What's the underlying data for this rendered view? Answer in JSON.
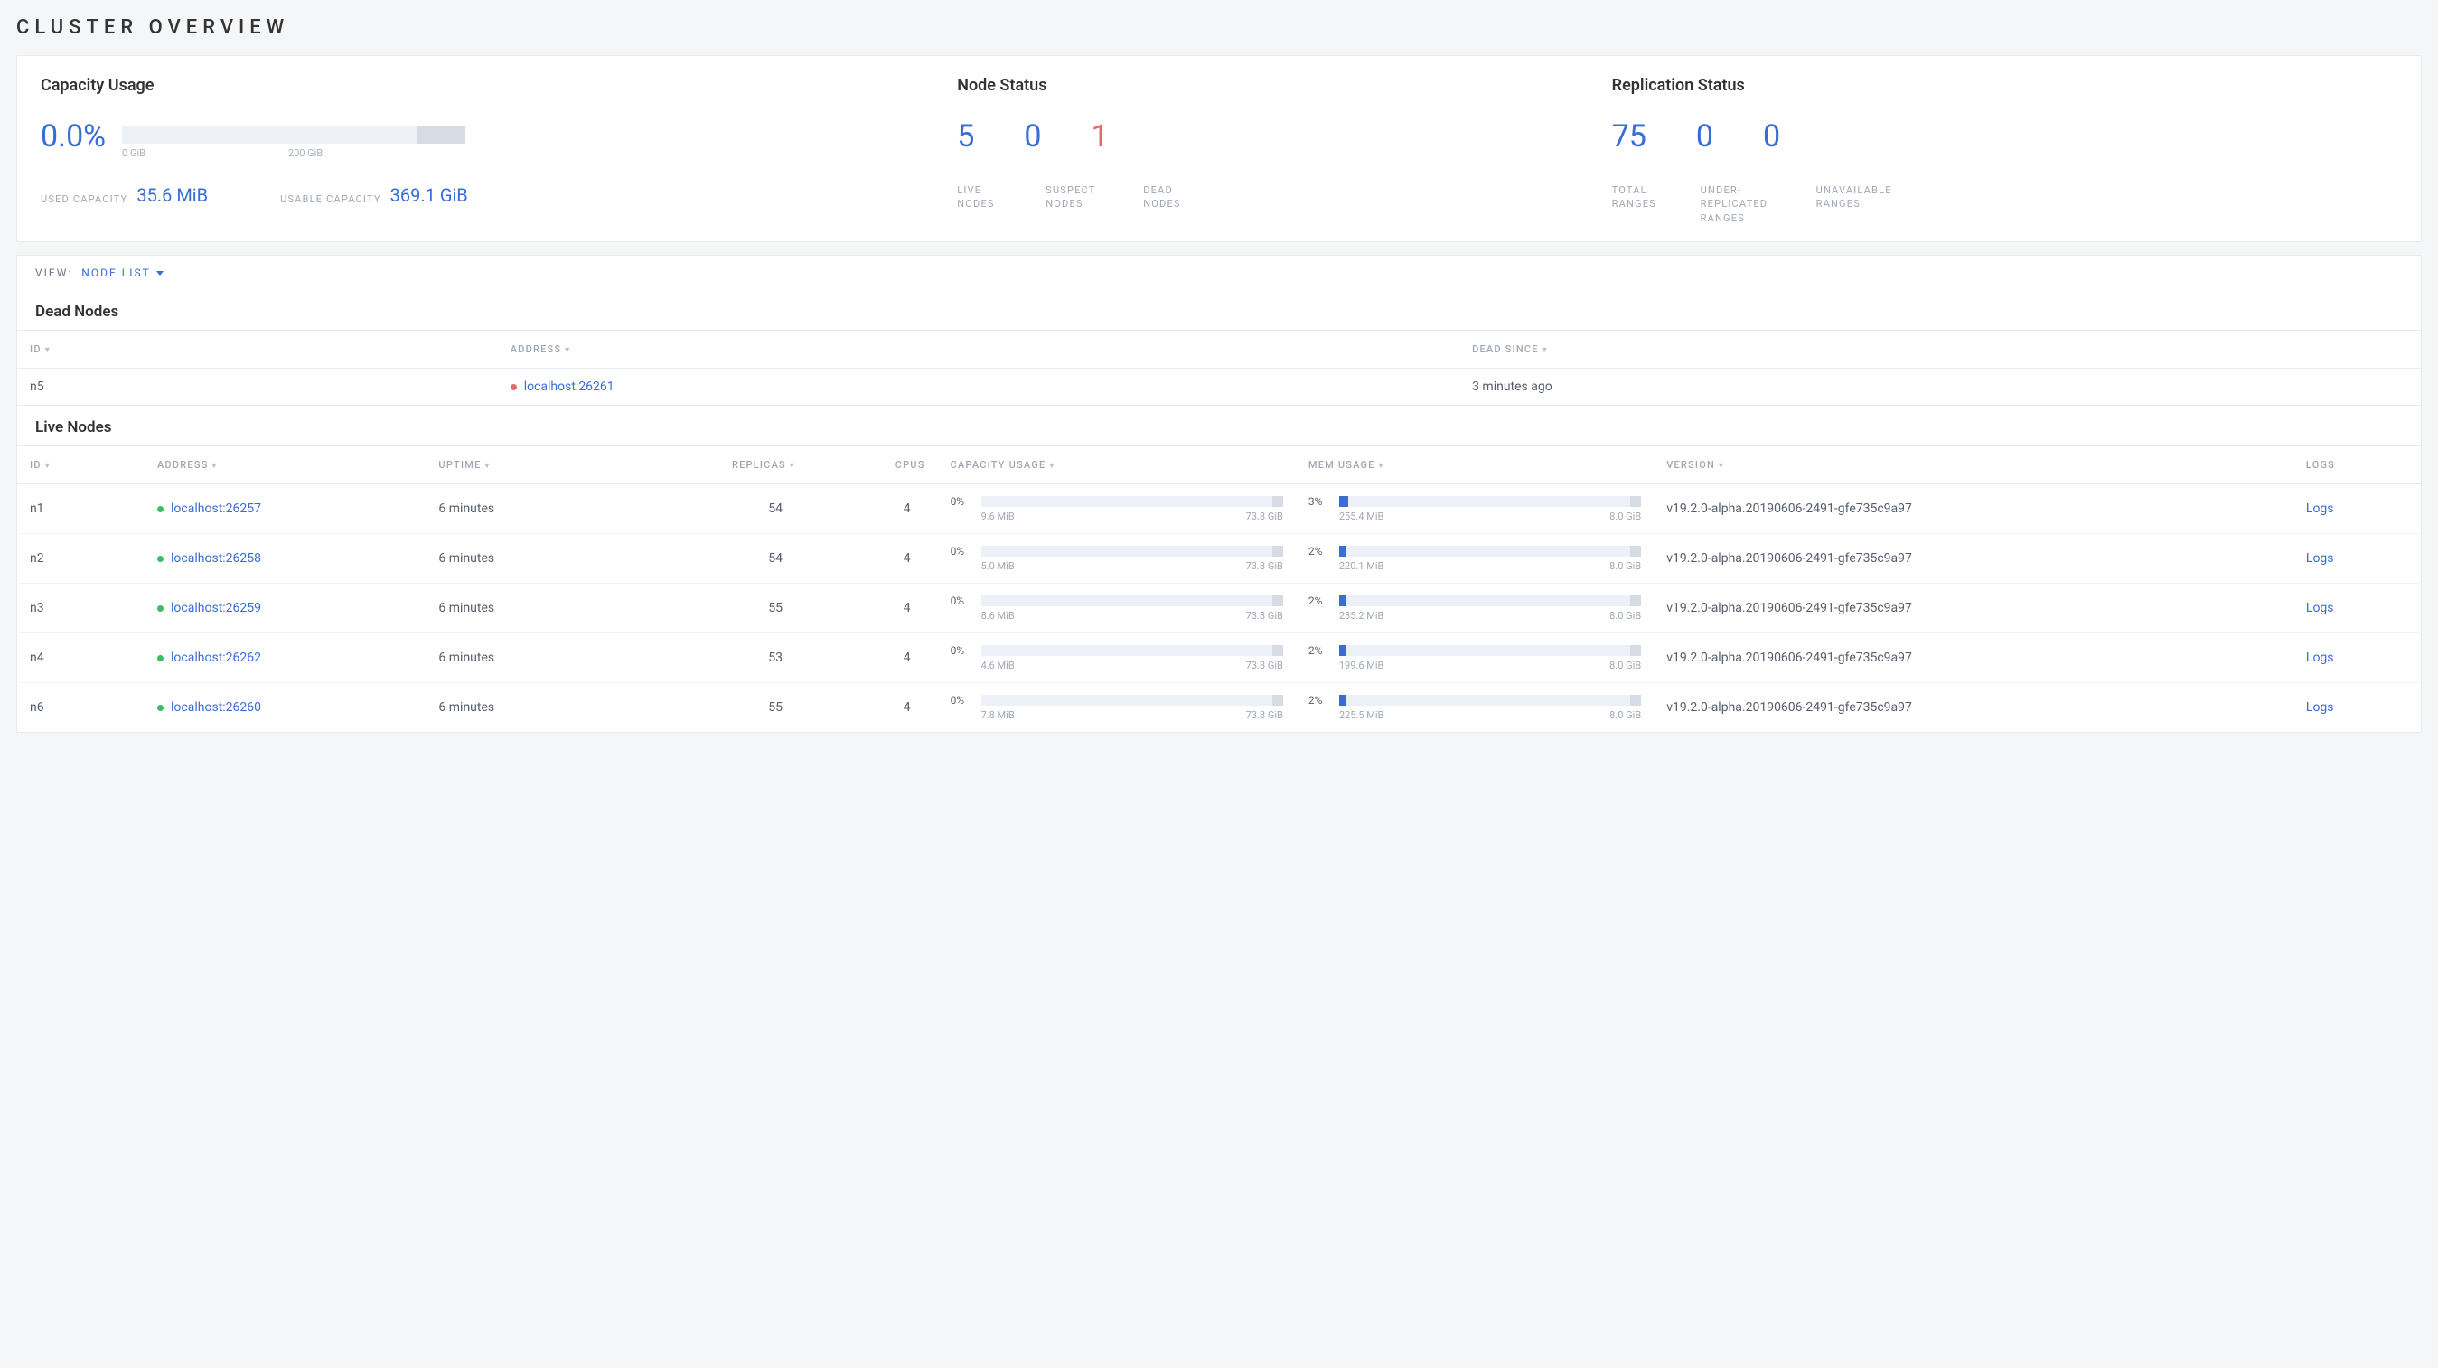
{
  "title": "CLUSTER OVERVIEW",
  "capacity": {
    "title": "Capacity Usage",
    "percent": "0.0%",
    "bar_labels": [
      "0 GiB",
      "200 GiB"
    ],
    "used_label": "USED CAPACITY",
    "used_value": "35.6 MiB",
    "usable_label": "USABLE CAPACITY",
    "usable_value": "369.1 GiB"
  },
  "node_status": {
    "title": "Node Status",
    "live": {
      "value": "5",
      "label": "LIVE NODES"
    },
    "suspect": {
      "value": "0",
      "label": "SUSPECT NODES"
    },
    "dead": {
      "value": "1",
      "label": "DEAD NODES"
    }
  },
  "replication": {
    "title": "Replication Status",
    "total": {
      "value": "75",
      "label": "TOTAL RANGES"
    },
    "under": {
      "value": "0",
      "label": "UNDER-REPLICATED RANGES"
    },
    "unavail": {
      "value": "0",
      "label": "UNAVAILABLE RANGES"
    }
  },
  "view": {
    "label": "VIEW:",
    "value": "NODE LIST"
  },
  "dead_nodes": {
    "title": "Dead Nodes",
    "headers": {
      "id": "ID",
      "address": "ADDRESS",
      "dead_since": "DEAD SINCE"
    },
    "rows": [
      {
        "id": "n5",
        "address": "localhost:26261",
        "dead_since": "3 minutes ago"
      }
    ]
  },
  "live_nodes": {
    "title": "Live Nodes",
    "headers": {
      "id": "ID",
      "address": "ADDRESS",
      "uptime": "UPTIME",
      "replicas": "REPLICAS",
      "cpus": "CPUS",
      "cap": "CAPACITY USAGE",
      "mem": "MEM USAGE",
      "version": "VERSION",
      "logs": "LOGS"
    },
    "rows": [
      {
        "id": "n1",
        "address": "localhost:26257",
        "uptime": "6 minutes",
        "replicas": "54",
        "cpus": "4",
        "cap": {
          "pct": "0%",
          "used": "9.6 MiB",
          "total": "73.8 GiB",
          "fill": 0
        },
        "mem": {
          "pct": "3%",
          "used": "255.4 MiB",
          "total": "8.0 GiB",
          "fill": 3
        },
        "version": "v19.2.0-alpha.20190606-2491-gfe735c9a97",
        "logs": "Logs"
      },
      {
        "id": "n2",
        "address": "localhost:26258",
        "uptime": "6 minutes",
        "replicas": "54",
        "cpus": "4",
        "cap": {
          "pct": "0%",
          "used": "5.0 MiB",
          "total": "73.8 GiB",
          "fill": 0
        },
        "mem": {
          "pct": "2%",
          "used": "220.1 MiB",
          "total": "8.0 GiB",
          "fill": 2
        },
        "version": "v19.2.0-alpha.20190606-2491-gfe735c9a97",
        "logs": "Logs"
      },
      {
        "id": "n3",
        "address": "localhost:26259",
        "uptime": "6 minutes",
        "replicas": "55",
        "cpus": "4",
        "cap": {
          "pct": "0%",
          "used": "8.6 MiB",
          "total": "73.8 GiB",
          "fill": 0
        },
        "mem": {
          "pct": "2%",
          "used": "235.2 MiB",
          "total": "8.0 GiB",
          "fill": 2
        },
        "version": "v19.2.0-alpha.20190606-2491-gfe735c9a97",
        "logs": "Logs"
      },
      {
        "id": "n4",
        "address": "localhost:26262",
        "uptime": "6 minutes",
        "replicas": "53",
        "cpus": "4",
        "cap": {
          "pct": "0%",
          "used": "4.6 MiB",
          "total": "73.8 GiB",
          "fill": 0
        },
        "mem": {
          "pct": "2%",
          "used": "199.6 MiB",
          "total": "8.0 GiB",
          "fill": 2
        },
        "version": "v19.2.0-alpha.20190606-2491-gfe735c9a97",
        "logs": "Logs"
      },
      {
        "id": "n6",
        "address": "localhost:26260",
        "uptime": "6 minutes",
        "replicas": "55",
        "cpus": "4",
        "cap": {
          "pct": "0%",
          "used": "7.8 MiB",
          "total": "73.8 GiB",
          "fill": 0
        },
        "mem": {
          "pct": "2%",
          "used": "225.5 MiB",
          "total": "8.0 GiB",
          "fill": 2
        },
        "version": "v19.2.0-alpha.20190606-2491-gfe735c9a97",
        "logs": "Logs"
      }
    ]
  }
}
